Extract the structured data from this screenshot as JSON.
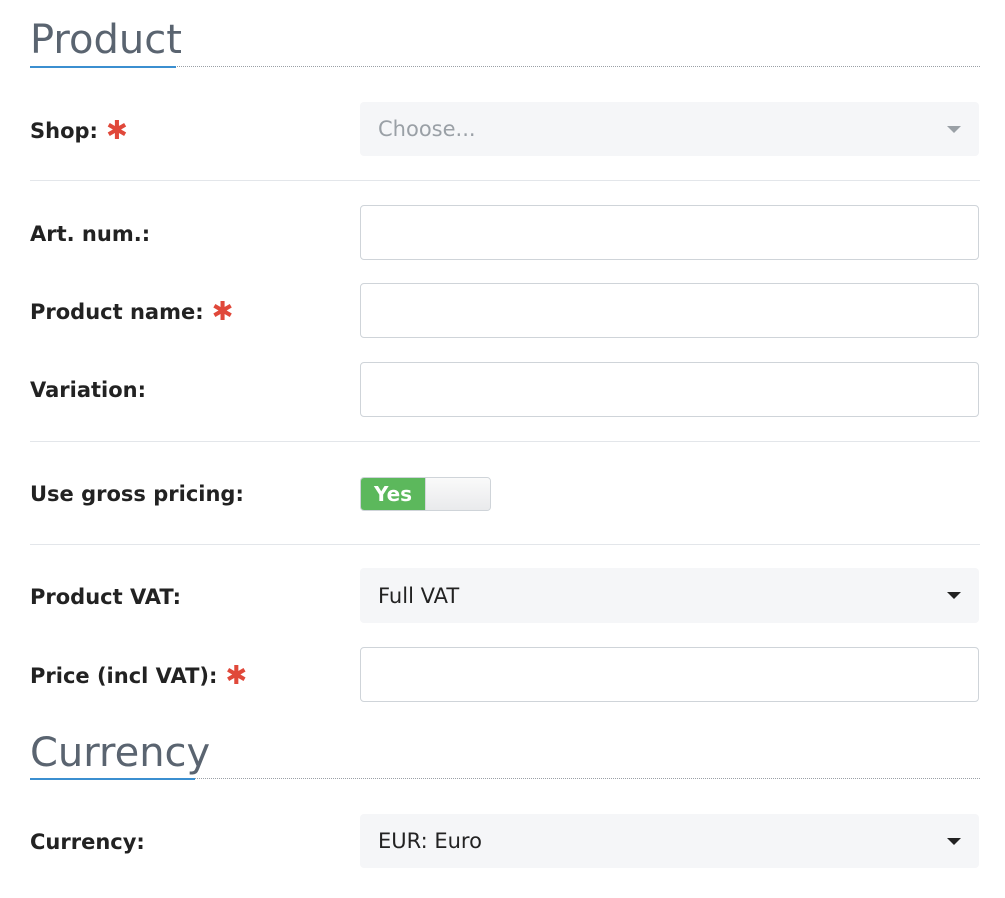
{
  "sections": {
    "product": {
      "title": "Product"
    },
    "currency": {
      "title": "Currency"
    }
  },
  "fields": {
    "shop": {
      "label": "Shop:",
      "required": "✱",
      "placeholder": "Choose..."
    },
    "art_num": {
      "label": "Art. num.:",
      "value": ""
    },
    "product_name": {
      "label": "Product name:",
      "required": "✱",
      "value": ""
    },
    "variation": {
      "label": "Variation:",
      "value": ""
    },
    "gross_pricing": {
      "label": "Use gross pricing:",
      "state_label": "Yes",
      "enabled": true
    },
    "product_vat": {
      "label": "Product VAT:",
      "selected": "Full VAT"
    },
    "price": {
      "label": "Price (incl VAT):",
      "required": "✱",
      "value": ""
    },
    "currency": {
      "label": "Currency:",
      "selected": "EUR: Euro"
    }
  },
  "colors": {
    "required_marker": "#e0483a",
    "toggle_on": "#5cb85c",
    "heading_underline": "#3b8fd0"
  }
}
